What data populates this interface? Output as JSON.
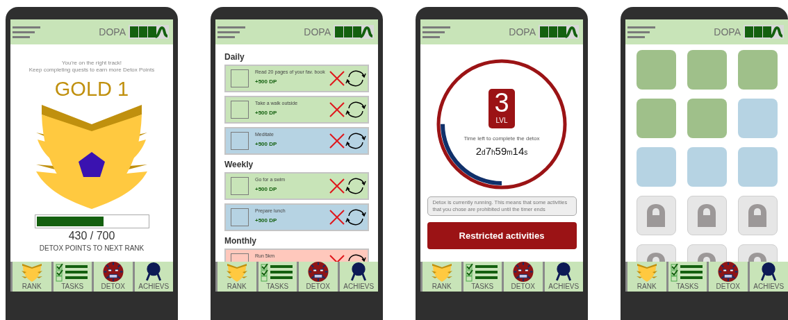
{
  "phones": [
    {
      "header": {
        "brand": "DOPA"
      },
      "screen": {
        "kind": "rank",
        "message": [
          "You're on the right track!",
          "Keep completing quests to earn more Detox Points"
        ],
        "rank": "GOLD 1",
        "progress": {
          "level": 0.61,
          "reading": "430 / 700",
          "caption": "DETOX POINTS TO NEXT RANK"
        }
      },
      "nav": [
        {
          "kind": "rank",
          "label": "RANK"
        },
        {
          "kind": "tasks",
          "label": "TASKS"
        },
        {
          "kind": "detox",
          "label": "DETOX"
        },
        {
          "kind": "achievements",
          "label": "ACHIEVS"
        }
      ]
    },
    {
      "header": {
        "brand": "DOPA"
      },
      "screen": {
        "kind": "tasks",
        "sections": [
          {
            "title": "Daily",
            "tasks": [
              {
                "title": "Read 20 pages of your fav. book",
                "points": "+500 DP",
                "checked": false,
                "color": "#c8e4b8"
              },
              {
                "title": "Take a walk outside",
                "points": "+500 DP",
                "checked": false,
                "color": "#c8e4b8"
              },
              {
                "title": "Meditate",
                "points": "+500 DP",
                "checked": false,
                "color": "#b6d3e3"
              }
            ]
          },
          {
            "title": "Weekly",
            "tasks": [
              {
                "title": "Go for a swim",
                "points": "+500 DP",
                "checked": false,
                "color": "#c8e4b8"
              },
              {
                "title": "Prepare lunch",
                "points": "+500 DP",
                "checked": false,
                "color": "#b6d3e3"
              }
            ]
          },
          {
            "title": "Monthly",
            "tasks": [
              {
                "title": "Run 5km",
                "checked": false,
                "color": "#ffc8bc"
              }
            ]
          }
        ]
      },
      "nav": [
        {
          "kind": "rank",
          "label": "RANK"
        },
        {
          "kind": "tasks",
          "label": "TASKS"
        },
        {
          "kind": "detox",
          "label": "DETOX"
        },
        {
          "kind": "achievements",
          "label": "ACHIEVS"
        }
      ]
    },
    {
      "header": {
        "brand": "DOPA"
      },
      "screen": {
        "kind": "detox",
        "level_number": "3",
        "level_label": "LVL",
        "level": 0.25,
        "caption": "Time left to complete the detox",
        "timer": "2$_{d}$7$_{h}$59$_{m}$14$_{s}$",
        "notice": "Detox is currently running. This means that some activities that you chose are prohibited until the timer ends",
        "button": "Restricted activities"
      },
      "nav": [
        {
          "kind": "rank",
          "label": "RANK"
        },
        {
          "kind": "tasks",
          "label": "TASKS"
        },
        {
          "kind": "detox",
          "label": "DETOX"
        },
        {
          "kind": "achievements",
          "label": "ACHIEVS"
        }
      ]
    },
    {
      "header": {
        "brand": "DOPA"
      },
      "screen": {
        "kind": "achievements",
        "tiles": [
          {
            "kind": "unlocked",
            "color": "#9fc08a"
          },
          {
            "kind": "unlocked",
            "color": "#9fc08a"
          },
          {
            "kind": "unlocked",
            "color": "#9fc08a"
          },
          {
            "kind": "unlocked",
            "color": "#9fc08a"
          },
          {
            "kind": "unlocked",
            "color": "#9fc08a"
          },
          {
            "kind": "unlocked",
            "color": "#b6d3e3"
          },
          {
            "kind": "unlocked",
            "color": "#b6d3e3"
          },
          {
            "kind": "unlocked",
            "color": "#b6d3e3"
          },
          {
            "kind": "unlocked",
            "color": "#b6d3e3"
          },
          {
            "kind": "locked"
          },
          {
            "kind": "locked"
          },
          {
            "kind": "locked"
          },
          {
            "kind": "locked"
          },
          {
            "kind": "locked"
          },
          {
            "kind": "locked"
          }
        ]
      },
      "nav": [
        {
          "kind": "rank",
          "label": "RANK"
        },
        {
          "kind": "tasks",
          "label": "TASKS"
        },
        {
          "kind": "detox",
          "label": "DETOX"
        },
        {
          "kind": "achievements",
          "label": "ACHIEVS"
        }
      ]
    }
  ]
}
